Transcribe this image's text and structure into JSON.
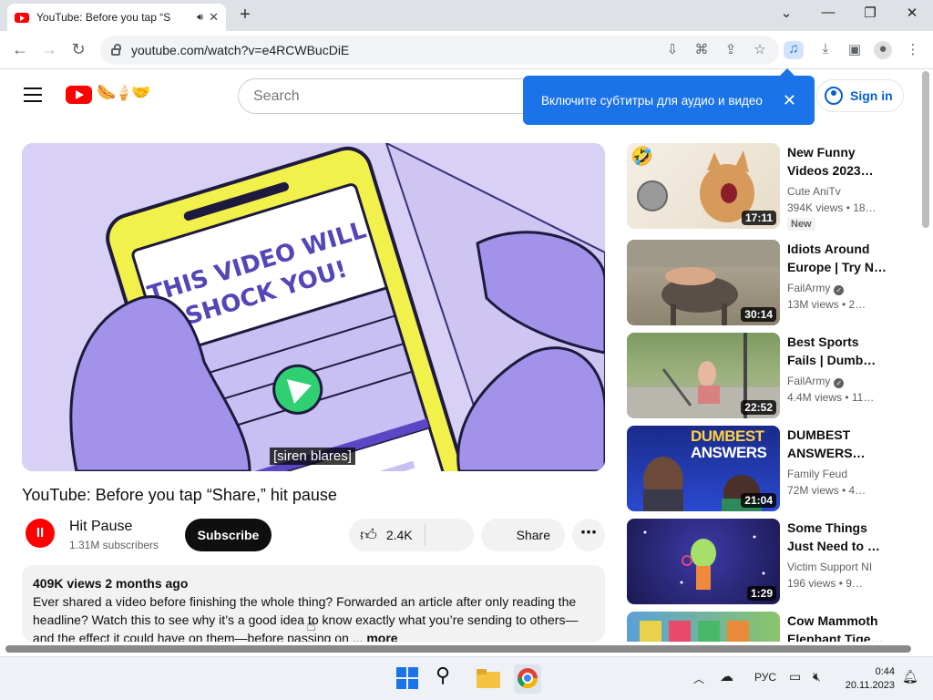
{
  "browser": {
    "tab_title": "YouTube: Before you tap “S",
    "tab_audio_icon": "speaker-icon",
    "url": "youtube.com/watch?v=e4RCWBucDiE"
  },
  "header": {
    "search_placeholder": "Search",
    "signin_label": "Sign in",
    "tooltip_text": "Включите субтитры для аудио и видео",
    "tooltip_close": "✕"
  },
  "player": {
    "caption": "[siren blares]",
    "overlay_text_1": "THIS VIDEO WILL",
    "overlay_text_2": "SHOCK YOU!"
  },
  "video": {
    "title": "YouTube: Before you tap “Share,” hit pause",
    "channel_name": "Hit Pause",
    "channel_initial": "II",
    "subscribers": "1.31M subscribers",
    "subscribe_label": "Subscribe",
    "likes": "2.4K",
    "share_label": "Share",
    "more_label": "⋯",
    "desc_meta": "409K views  2 months ago",
    "desc_text": "Ever shared a video before finishing the whole thing? Forwarded an article after only reading the headline? Watch this to see why it’s a good idea to know exactly what you’re sending to others—and the effect it could have on them—before passing on ...",
    "desc_more": "more"
  },
  "recommendations": [
    {
      "title": "New Funny Videos 2023…",
      "channel": "Cute AniTv",
      "verified": false,
      "meta": "394K views  • 18…",
      "duration": "17:11",
      "badge": "New"
    },
    {
      "title": "Idiots Around Europe | Try N…",
      "channel": "FailArmy",
      "verified": true,
      "meta": "13M views  • 2…",
      "duration": "30:14",
      "badge": ""
    },
    {
      "title": "Best Sports Fails | Dumb…",
      "channel": "FailArmy",
      "verified": true,
      "meta": "4.4M views  • 11…",
      "duration": "22:52",
      "badge": ""
    },
    {
      "title": "DUMBEST ANSWERS…",
      "channel": "Family Feud",
      "verified": false,
      "meta": "72M views  • 4…",
      "duration": "21:04",
      "badge": "",
      "thumb_text_1": "DUMBEST",
      "thumb_text_2": "ANSWERS"
    },
    {
      "title": "Some Things Just Need to …",
      "channel": "Victim Support NI",
      "verified": false,
      "meta": "196 views  • 9…",
      "duration": "1:29",
      "badge": ""
    },
    {
      "title": "Cow Mammoth Elephant Tige…",
      "channel": "",
      "verified": false,
      "meta": "",
      "duration": "",
      "badge": ""
    }
  ],
  "taskbar": {
    "lang": "РУС",
    "time": "0:44",
    "date": "20.11.2023"
  },
  "colors": {
    "yt_red": "#ff0000",
    "accent_blue": "#1a73e8",
    "link_blue": "#065fd4"
  }
}
